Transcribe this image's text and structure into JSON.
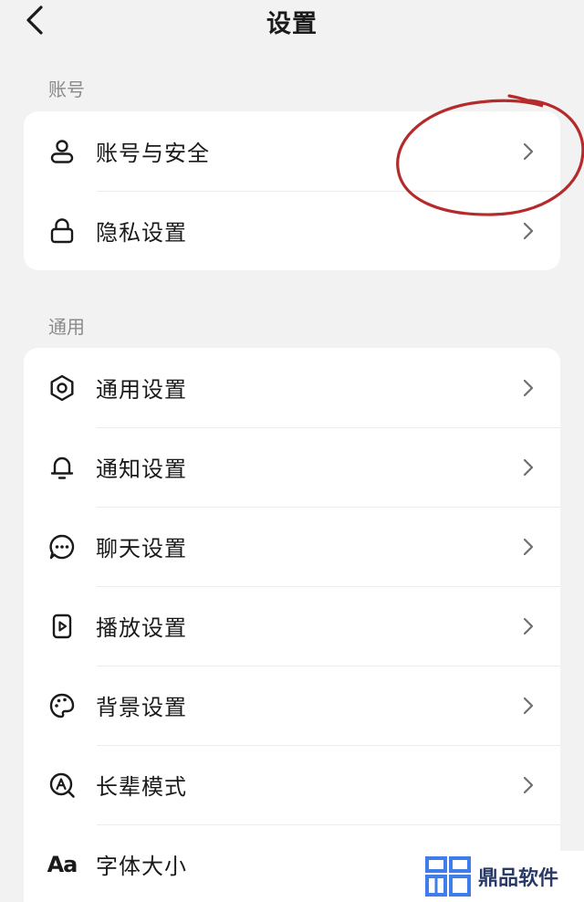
{
  "header": {
    "title": "设置"
  },
  "sections": [
    {
      "title": "账号",
      "items": [
        {
          "label": "账号与安全",
          "icon": "user-icon"
        },
        {
          "label": "隐私设置",
          "icon": "lock-icon"
        }
      ]
    },
    {
      "title": "通用",
      "items": [
        {
          "label": "通用设置",
          "icon": "gear-icon"
        },
        {
          "label": "通知设置",
          "icon": "bell-icon"
        },
        {
          "label": "聊天设置",
          "icon": "chat-bubble-icon"
        },
        {
          "label": "播放设置",
          "icon": "play-icon"
        },
        {
          "label": "背景设置",
          "icon": "palette-icon"
        },
        {
          "label": "长辈模式",
          "icon": "elder-mode-icon"
        },
        {
          "label": "字体大小",
          "icon": "font-size-icon",
          "icon_text": "Aa"
        }
      ]
    }
  ],
  "annotation": {
    "color": "#b52a2a"
  },
  "watermark": {
    "text": "鼎品软件",
    "color": "#2a3a66",
    "logo_color": "#3f7ee8"
  }
}
